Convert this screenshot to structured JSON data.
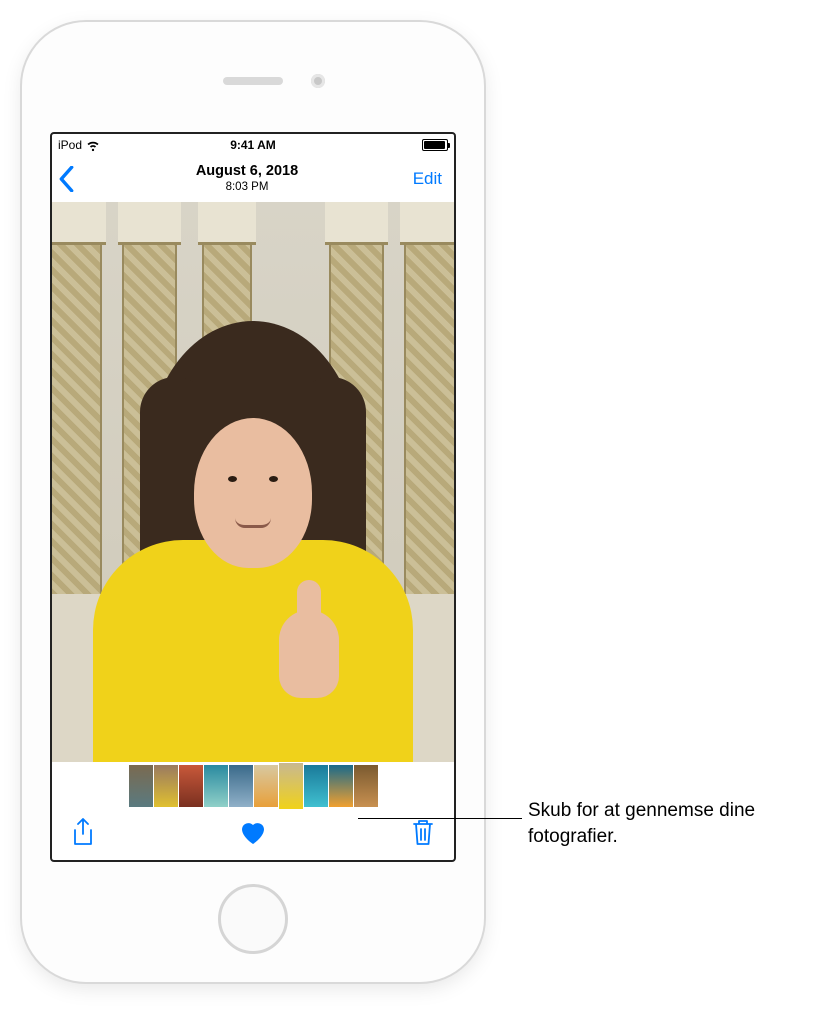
{
  "status": {
    "carrier": "iPod",
    "time": "9:41 AM"
  },
  "nav": {
    "date": "August 6, 2018",
    "time": "8:03 PM",
    "edit_label": "Edit"
  },
  "toolbar": {
    "share_name": "share-icon",
    "favorite_name": "heart-icon",
    "delete_name": "trash-icon"
  },
  "callout": {
    "text": "Skub for at gennemse dine fotografier."
  },
  "thumbnail_count": 10,
  "selected_thumbnail_index": 6
}
